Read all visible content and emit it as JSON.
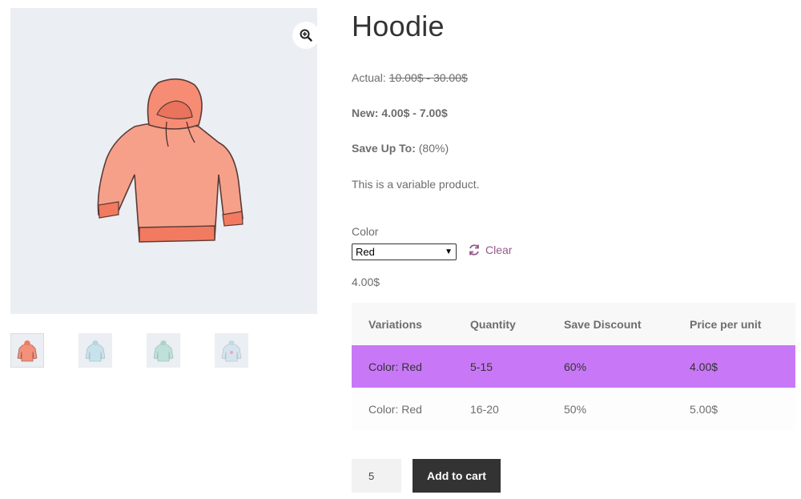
{
  "gallery": {
    "zoom_icon": "magnifier-plus-icon",
    "main_image_color": "#f4917b",
    "thumbnails": [
      {
        "name": "hoodie-red",
        "color": "#f4917b"
      },
      {
        "name": "hoodie-blue",
        "color": "#c7e2ea"
      },
      {
        "name": "hoodie-green",
        "color": "#bfe0d8"
      },
      {
        "name": "hoodie-logo",
        "color": "#d6e4ee"
      }
    ]
  },
  "product": {
    "title": "Hoodie",
    "actual_label": "Actual:",
    "actual_range": "10.00$ - 30.00$",
    "new_label": "New: 4.00$ - 7.00$",
    "save_label": "Save Up To:",
    "save_value": "(80%)",
    "description": "This is a variable product."
  },
  "variation": {
    "color_label": "Color",
    "selected": "Red",
    "clear_label": "Clear",
    "price": "4.00$"
  },
  "table": {
    "headers": [
      "Variations",
      "Quantity",
      "Save Discount",
      "Price per unit"
    ],
    "rows": [
      [
        "Color: Red",
        "5-15",
        "60%",
        "4.00$"
      ],
      [
        "Color: Red",
        "16-20",
        "50%",
        "5.00$"
      ]
    ],
    "highlight_color": "#c878f6"
  },
  "cart": {
    "quantity": "5",
    "add_label": "Add to cart"
  }
}
